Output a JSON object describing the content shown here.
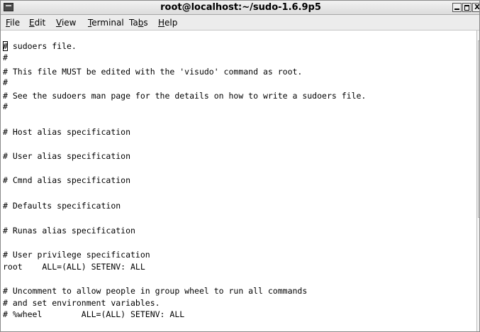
{
  "window": {
    "title": "root@localhost:~/sudo-1.6.9p5",
    "close_glyph": "X"
  },
  "menubar": {
    "items": [
      {
        "pre": "",
        "mnemonic": "F",
        "post": "ile"
      },
      {
        "pre": "",
        "mnemonic": "E",
        "post": "dit"
      },
      {
        "pre": "",
        "mnemonic": "V",
        "post": "iew"
      },
      {
        "pre": "",
        "mnemonic": "T",
        "post": "erminal"
      },
      {
        "pre": "Ta",
        "mnemonic": "b",
        "post": "s"
      },
      {
        "pre": "",
        "mnemonic": "H",
        "post": "elp"
      }
    ]
  },
  "terminal": {
    "lines": [
      "# sudoers file.",
      "#",
      "# This file MUST be edited with the 'visudo' command as root.",
      "#",
      "# See the sudoers man page for the details on how to write a sudoers file.",
      "#",
      "",
      "# Host alias specification",
      "",
      "# User alias specification",
      "",
      "# Cmnd alias specification",
      "",
      "# Defaults specification",
      "",
      "# Runas alias specification",
      "",
      "# User privilege specification",
      "root    ALL=(ALL) SETENV: ALL",
      "",
      "# Uncomment to allow people in group wheel to run all commands",
      "# and set environment variables.",
      "# %wheel        ALL=(ALL) SETENV: ALL"
    ]
  }
}
